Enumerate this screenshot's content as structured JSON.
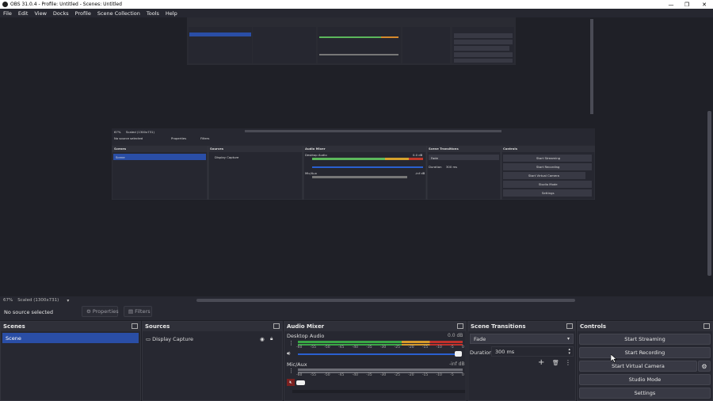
{
  "window": {
    "title": "OBS 31.0.4 - Profile: Untitled - Scenes: Untitled",
    "minimize": "—",
    "maximize": "❐",
    "close": "✕"
  },
  "menu": [
    "File",
    "Edit",
    "View",
    "Docks",
    "Profile",
    "Scene Collection",
    "Tools",
    "Help"
  ],
  "status": {
    "zoom": "67%",
    "scale": "Scaled (1300x731)"
  },
  "source_bar": {
    "selected": "No source selected",
    "properties": "Properties",
    "filters": "Filters"
  },
  "scenes": {
    "title": "Scenes",
    "items": [
      "Scene"
    ]
  },
  "sources": {
    "title": "Sources",
    "items": [
      {
        "label": "Display Capture"
      }
    ]
  },
  "mixer": {
    "title": "Audio Mixer",
    "channels": [
      {
        "name": "Desktop Audio",
        "level": "0.0 dB",
        "volume_fraction": 1.0
      },
      {
        "name": "Mic/Aux",
        "level": "-inf dB",
        "volume_fraction": 0.0
      }
    ],
    "ticks": [
      "-60",
      "-55",
      "-50",
      "-45",
      "-40",
      "-35",
      "-30",
      "-25",
      "-20",
      "-15",
      "-10",
      "-5",
      "0"
    ]
  },
  "transitions": {
    "title": "Scene Transitions",
    "selected": "Fade",
    "duration_label": "Duration",
    "duration_value": "300 ms"
  },
  "controls": {
    "title": "Controls",
    "start_streaming": "Start Streaming",
    "start_recording": "Start Recording",
    "start_virtual_camera": "Start Virtual Camera",
    "studio_mode": "Studio Mode",
    "settings": "Settings"
  }
}
